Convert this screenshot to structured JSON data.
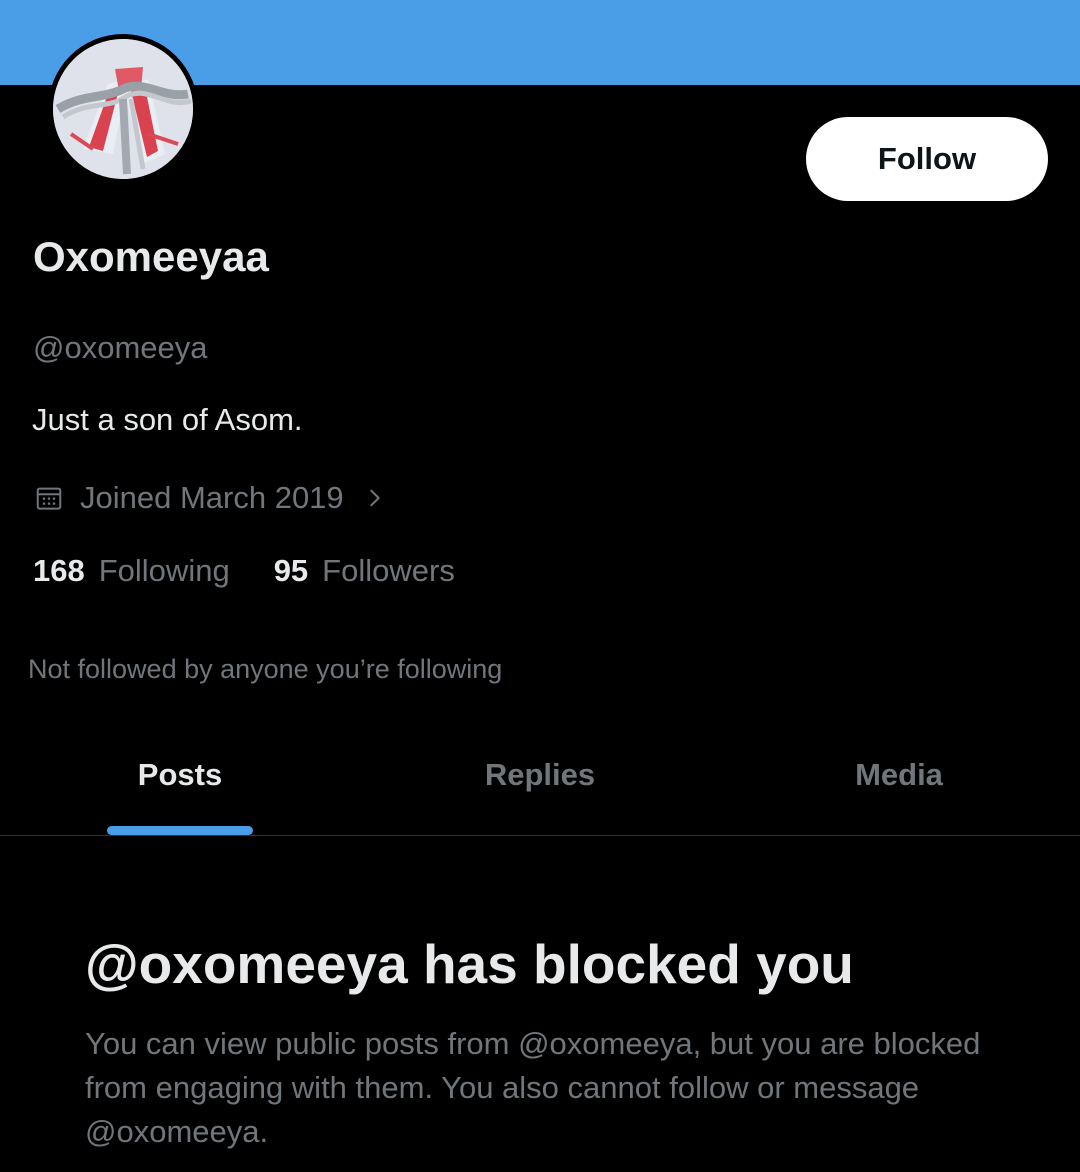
{
  "colors": {
    "banner": "#4a9ee8",
    "background": "#000000",
    "primary_text": "#e7e9ea",
    "secondary_text": "#71767b",
    "accent": "#4a9ee8",
    "divider": "#2f3336"
  },
  "header": {
    "avatar_icon": "profile-avatar"
  },
  "profile": {
    "follow_label": "Follow",
    "display_name": "Oxomeeyaa",
    "handle": "@oxomeeya",
    "bio": "Just a son of Asom.",
    "joined_icon": "calendar-icon",
    "joined": "Joined March 2019",
    "joined_chevron_icon": "chevron-right-icon",
    "following_count": "168",
    "following_label": "Following",
    "followers_count": "95",
    "followers_label": "Followers",
    "not_followed_text": "Not followed by anyone you’re following"
  },
  "tabs": [
    {
      "label": "Posts",
      "active": true
    },
    {
      "label": "Replies",
      "active": false
    },
    {
      "label": "Media",
      "active": false
    }
  ],
  "blocked": {
    "title": "@oxomeeya has blocked you",
    "description": "You can view public posts from @oxomeeya, but you are blocked from engaging with them. You also cannot follow or message @oxomeeya."
  }
}
